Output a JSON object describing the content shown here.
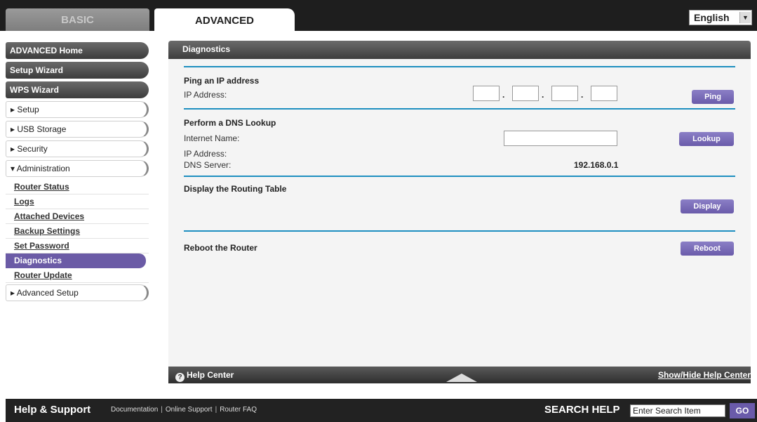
{
  "tabs": {
    "basic": "BASIC",
    "advanced": "ADVANCED"
  },
  "language": {
    "selected": "English"
  },
  "sidebar": {
    "top_items": [
      "ADVANCED Home",
      "Setup Wizard",
      "WPS Wizard"
    ],
    "sections": [
      "▸ Setup",
      "▸ USB Storage",
      "▸ Security",
      "▾ Administration"
    ],
    "admin_items": [
      "Router Status",
      "Logs",
      "Attached Devices",
      "Backup Settings",
      "Set Password",
      "Diagnostics",
      "Router Update"
    ],
    "advanced_setup": "▸ Advanced Setup"
  },
  "panel": {
    "title": "Diagnostics",
    "ping": {
      "title": "Ping an IP address",
      "ip_label": "IP Address:",
      "button": "Ping"
    },
    "dns": {
      "title": "Perform a DNS Lookup",
      "name_label": "Internet Name:",
      "ip_label": "IP Address:",
      "server_label": "DNS Server:",
      "server_value": "192.168.0.1",
      "button": "Lookup"
    },
    "routing": {
      "title": "Display the Routing Table",
      "button": "Display"
    },
    "reboot": {
      "title": "Reboot the Router",
      "button": "Reboot"
    }
  },
  "helpbar": {
    "left": "Help Center",
    "right": "Show/Hide Help Center"
  },
  "footer": {
    "title": "Help & Support",
    "links": [
      "Documentation",
      "Online Support",
      "Router FAQ"
    ],
    "search_label": "SEARCH HELP",
    "search_placeholder": "Enter Search Item",
    "go": "GO"
  },
  "colors": {
    "accent": "#6a5baa",
    "separator": "#1e8fc0",
    "dark": "#1e1e1e"
  }
}
